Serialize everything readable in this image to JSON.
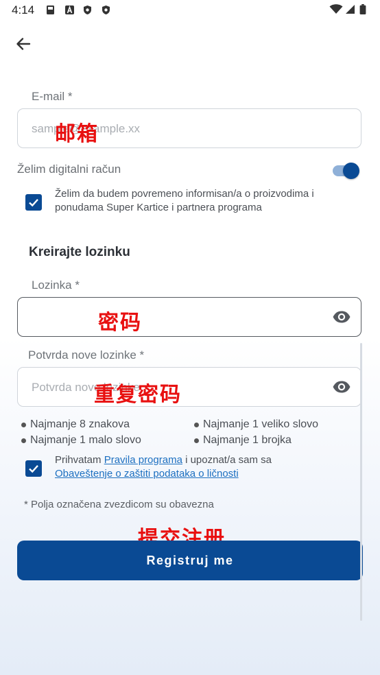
{
  "status_bar": {
    "time": "4:14"
  },
  "email": {
    "label": "E-mail *",
    "placeholder": "sample@example.xx",
    "annotation": "邮箱"
  },
  "digital_account": {
    "label": "Želim digitalni račun",
    "enabled": true
  },
  "newsletter": {
    "checked": true,
    "text": "Želim da budem povremeno informisan/a o proizvodima i ponudama Super Kartice i partnera programa"
  },
  "password_section": {
    "title": "Kreirajte lozinku",
    "password_label": "Lozinka *",
    "password_annotation": "密码",
    "confirm_label": "Potvrda nove lozinke *",
    "confirm_placeholder": "Potvrda nove lozinke",
    "confirm_annotation": "重复密码"
  },
  "rules": [
    "Najmanje 8 znakova",
    "Najmanje 1 veliko slovo",
    "Najmanje 1 malo slovo",
    "Najmanje 1 brojka"
  ],
  "terms": {
    "checked": true,
    "prefix": "Prihvatam ",
    "link1": "Pravila programa",
    "middle": " i upoznat/a sam sa",
    "link2": "Obaveštenje o zaštiti podataka o ličnosti"
  },
  "required_note": "* Polja označena zvezdicom su obavezna",
  "submit": {
    "annotation": "提交注册",
    "label": "Registruj me"
  },
  "colors": {
    "primary": "#0a4a94",
    "link": "#1c6fc0",
    "annotation": "#e81010"
  }
}
